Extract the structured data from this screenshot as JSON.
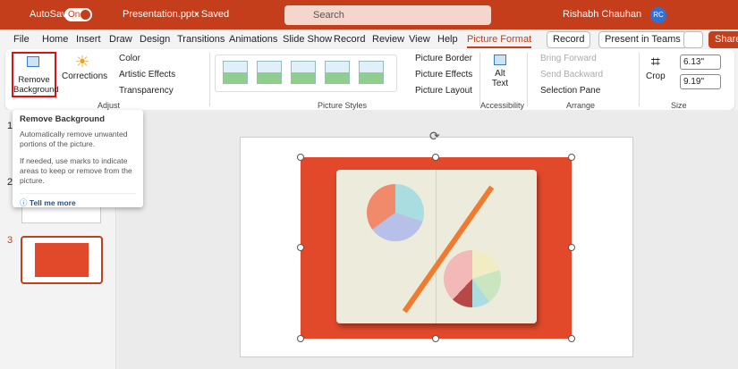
{
  "titlebar": {
    "autosave_label": "AutoSave",
    "autosave_state": "On",
    "filename": "Presentation.pptx",
    "save_status": "• Saved",
    "search_placeholder": "Search",
    "user_name": "Rishabh Chauhan",
    "user_initials": "RC"
  },
  "tabs": [
    "File",
    "Home",
    "Insert",
    "Draw",
    "Design",
    "Transitions",
    "Animations",
    "Slide Show",
    "Record",
    "Review",
    "View",
    "Help",
    "Picture Format"
  ],
  "active_tab": "Picture Format",
  "tab_buttons": {
    "record": "Record",
    "present": "Present in Teams",
    "share": "Share"
  },
  "ribbon": {
    "remove_background": "Remove Background",
    "corrections": "Corrections",
    "color": "Color",
    "artistic_effects": "Artistic Effects",
    "transparency": "Transparency",
    "group_adjust": "Adjust",
    "picture_border": "Picture Border",
    "picture_effects": "Picture Effects",
    "picture_layout": "Picture Layout",
    "group_styles": "Picture Styles",
    "alt_text": "Alt Text",
    "group_accessibility": "Accessibility",
    "bring_forward": "Bring Forward",
    "send_backward": "Send Backward",
    "selection_pane": "Selection Pane",
    "group_arrange": "Arrange",
    "crop": "Crop",
    "height": "6.13\"",
    "width": "9.19\"",
    "group_size": "Size"
  },
  "tooltip": {
    "title": "Remove Background",
    "p1": "Automatically remove unwanted portions of the picture.",
    "p2": "If needed, use marks to indicate areas to keep or remove from the picture.",
    "link": "Tell me more"
  },
  "slides": [
    "1",
    "2",
    "3"
  ],
  "colors": {
    "accent": "#c43e1c",
    "photo_bg": "#e2492a"
  }
}
